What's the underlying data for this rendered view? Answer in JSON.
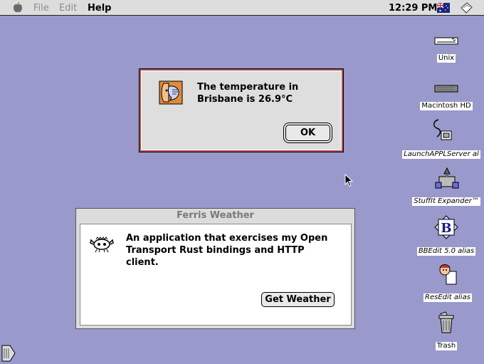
{
  "menubar": {
    "items": [
      {
        "label": "File",
        "enabled": false
      },
      {
        "label": "Edit",
        "enabled": false
      },
      {
        "label": "Help",
        "enabled": true
      }
    ],
    "clock": "12:29 PM"
  },
  "desktop_icons": [
    {
      "label": "Unix",
      "icon": "drive-icon"
    },
    {
      "label": "Macintosh HD",
      "icon": "hard-disk-icon"
    },
    {
      "label": "LaunchAPPLServer al",
      "icon": "serial-cable-icon"
    },
    {
      "label": "StuffIt Expander™",
      "icon": "stuffit-icon"
    },
    {
      "label": "BBEdit 5.0 alias",
      "icon": "bbedit-icon"
    },
    {
      "label": "ResEdit alias",
      "icon": "resedit-icon"
    },
    {
      "label": "Trash",
      "icon": "trash-icon"
    }
  ],
  "alert": {
    "line1": "The temperature in",
    "line2": "Brisbane is 26.9°C",
    "ok_label": "OK"
  },
  "ferris_window": {
    "title": "Ferris Weather",
    "line1": "An application that exercises my Open",
    "line2": "Transport Rust bindings and HTTP client.",
    "button_label": "Get Weather"
  },
  "colors": {
    "desktop": "#9999cc",
    "menubar": "#dddddd",
    "dialog": "#dedede",
    "alert_border": "#b05050"
  }
}
